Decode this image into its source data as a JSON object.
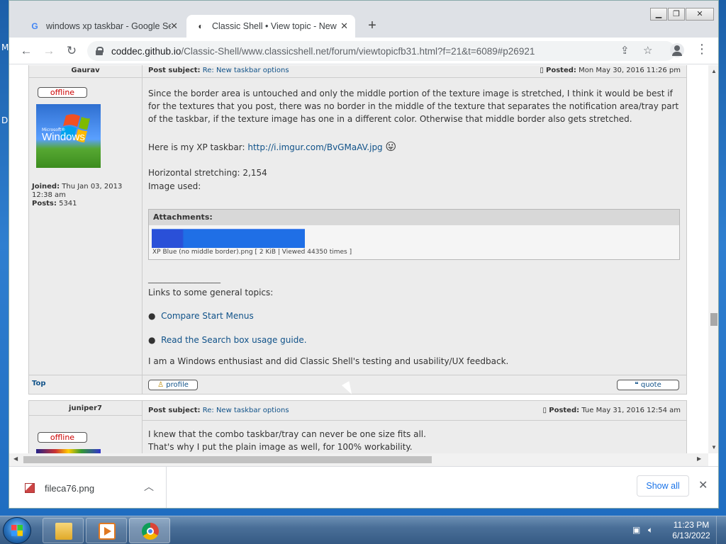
{
  "desktop": {
    "letters": [
      "M",
      "D"
    ]
  },
  "browser": {
    "window_controls": [
      "▁",
      "❐",
      "✕"
    ],
    "tabs": [
      {
        "title": "windows xp taskbar - Google Sea",
        "favicon": "G",
        "close": "✕"
      },
      {
        "title": "Classic Shell • View topic - New t",
        "favicon": "◐",
        "close": "✕"
      }
    ],
    "new_tab": "+",
    "nav": {
      "back": "←",
      "forward": "→",
      "reload": "↻"
    },
    "url_host": "coddec.github.io",
    "url_path": "/Classic-Shell/www.classicshell.net/forum/viewtopicfb31.html?f=21&t=6089#p26921",
    "share_icon": "⇪",
    "star_icon": "☆",
    "menu_icon": "⋮"
  },
  "post1": {
    "author": "Gaurav",
    "status": "offline",
    "avatar_ms": "Microsoft®",
    "avatar_word": "Windows",
    "joined_label": "Joined:",
    "joined_value": "Thu Jan 03, 2013 12:38 am",
    "posts_label": "Posts:",
    "posts_value": "5341",
    "subject_label": "Post subject:",
    "subject": "Re: New taskbar options",
    "posted_label": "Posted:",
    "posted": "Mon May 30, 2016 11:26 pm",
    "paragraph1": "Since the border area is untouched and only the middle portion of the texture image is stretched, I think it would be best if for the textures that you post, there was no border in the middle of the texture that separates the notification area/tray part of the taskbar, if the texture image has one in a different color. Otherwise that middle border also gets stretched.",
    "xp_taskbar_text": "Here is my XP taskbar:",
    "xp_taskbar_link": "http://i.imgur.com/BvGMaAV.jpg",
    "stretch_text": "Horizontal stretching: 2,154",
    "image_used": "Image used:",
    "attachments_label": "Attachments:",
    "attachment_caption": "XP Blue (no middle border).png [ 2 KiB | Viewed 44350 times ]",
    "signature_rule": "_________________",
    "links_intro": "Links to some general topics:",
    "links": [
      "Compare Start Menus",
      "Read the Search box usage guide."
    ],
    "signature_end": "I am a Windows enthusiast and did Classic Shell's testing and usability/UX feedback.",
    "top_link": "Top",
    "profile_btn": "profile",
    "quote_btn": "quote"
  },
  "post2": {
    "author": "juniper7",
    "status": "offline",
    "subject_label": "Post subject:",
    "subject": "Re: New taskbar options",
    "posted_label": "Posted:",
    "posted": "Tue May 31, 2016 12:54 am",
    "line1": "I knew that the combo taskbar/tray can never be one size fits all.",
    "line2": "That's why I put the plain image as well, for 100% workability."
  },
  "download": {
    "filename": "fileca76.png",
    "chevron": "︿",
    "show_all": "Show all",
    "close": "✕"
  },
  "taskbar": {
    "time": "11:23 PM",
    "date": "6/13/2022"
  }
}
